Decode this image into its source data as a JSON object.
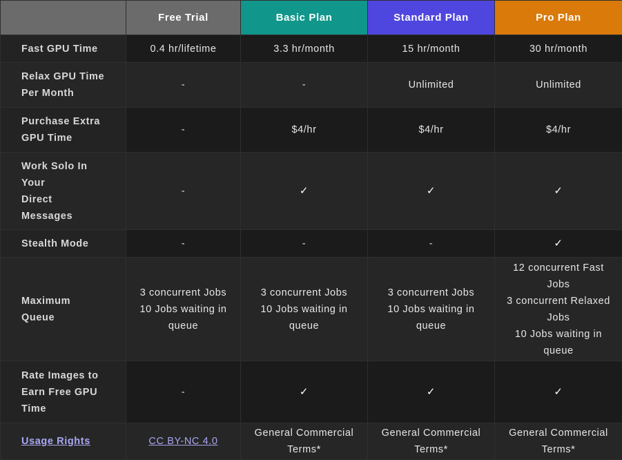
{
  "header": {
    "plans": [
      {
        "name": "Free Trial",
        "color": "#6b6b6b"
      },
      {
        "name": "Basic Plan",
        "color": "#10968a"
      },
      {
        "name": "Standard Plan",
        "color": "#4f46e0"
      },
      {
        "name": "Pro Plan",
        "color": "#d97a0a"
      }
    ]
  },
  "rows": [
    {
      "feature": "Fast GPU Time",
      "values": [
        "0.4 hr/lifetime",
        "3.3 hr/month",
        "15 hr/month",
        "30 hr/month"
      ]
    },
    {
      "feature": "Relax GPU Time Per Month",
      "values": [
        "-",
        "-",
        "Unlimited",
        "Unlimited"
      ]
    },
    {
      "feature": "Purchase Extra GPU Time",
      "values": [
        "-",
        "$4/hr",
        "$4/hr",
        "$4/hr"
      ]
    },
    {
      "feature": "Work Solo In Your Direct Messages",
      "values": [
        "-",
        "✓",
        "✓",
        "✓"
      ]
    },
    {
      "feature": "Stealth Mode",
      "values": [
        "-",
        "-",
        "-",
        "✓"
      ]
    },
    {
      "feature": "Maximum Queue",
      "values": [
        "3 concurrent Jobs 10 Jobs waiting in queue",
        "3 concurrent Jobs 10 Jobs waiting in queue",
        "3 concurrent Jobs 10 Jobs waiting in queue",
        "12 concurrent Fast Jobs 3 concurrent Relaxed Jobs 10 Jobs waiting in queue"
      ]
    },
    {
      "feature": "Rate Images to Earn Free GPU Time",
      "values": [
        "-",
        "✓",
        "✓",
        "✓"
      ]
    },
    {
      "feature": "Usage Rights",
      "values": [
        "CC BY-NC 4.0",
        "General Commercial Terms*",
        "General Commercial Terms*",
        "General Commercial Terms*"
      ]
    }
  ],
  "display": {
    "r3f": [
      "Work Solo In",
      "Your",
      "Direct",
      "Messages"
    ],
    "r5v": [
      "3 concurrent Jobs",
      "10 Jobs waiting in",
      "queue"
    ],
    "r5pro": [
      "12 concurrent Fast",
      "Jobs",
      "3 concurrent Relaxed",
      "Jobs",
      "10 Jobs waiting in",
      "queue"
    ]
  }
}
